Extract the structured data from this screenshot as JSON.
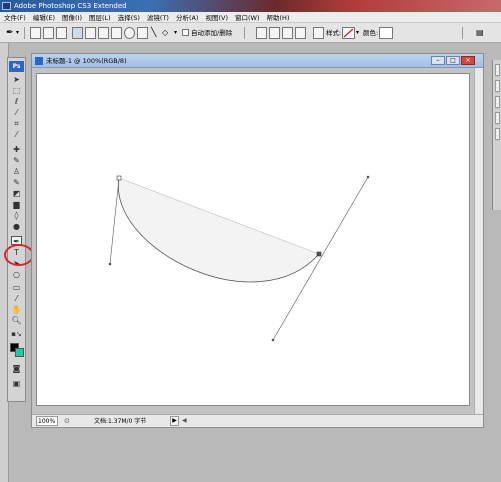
{
  "window": {
    "title": "Adobe Photoshop CS3 Extended"
  },
  "menu": {
    "items": [
      "文件(F)",
      "编辑(E)",
      "图像(I)",
      "图层(L)",
      "选择(S)",
      "滤镜(T)",
      "分析(A)",
      "视图(V)",
      "窗口(W)",
      "帮助(H)"
    ]
  },
  "options": {
    "auto_add_delete_label": "自动添加/删除",
    "style_label": "样式:",
    "color_label": "颜色:"
  },
  "toolbox": {
    "logo": "Ps",
    "highlighted_tool": "pen-tool",
    "highlight_color": "#d8252a"
  },
  "document": {
    "title": "未标题-1 @ 100%(RGB/8)",
    "minimize_glyph": "–",
    "maximize_glyph": "□",
    "close_glyph": "✕"
  },
  "status": {
    "zoom": "100%",
    "doc_info": "文档:1.37M/0 字节",
    "play_glyph": "▶",
    "arrow_left_glyph": "◀"
  },
  "path": {
    "stroke_color": "#555555",
    "fill_color": "#f3f3f3"
  }
}
